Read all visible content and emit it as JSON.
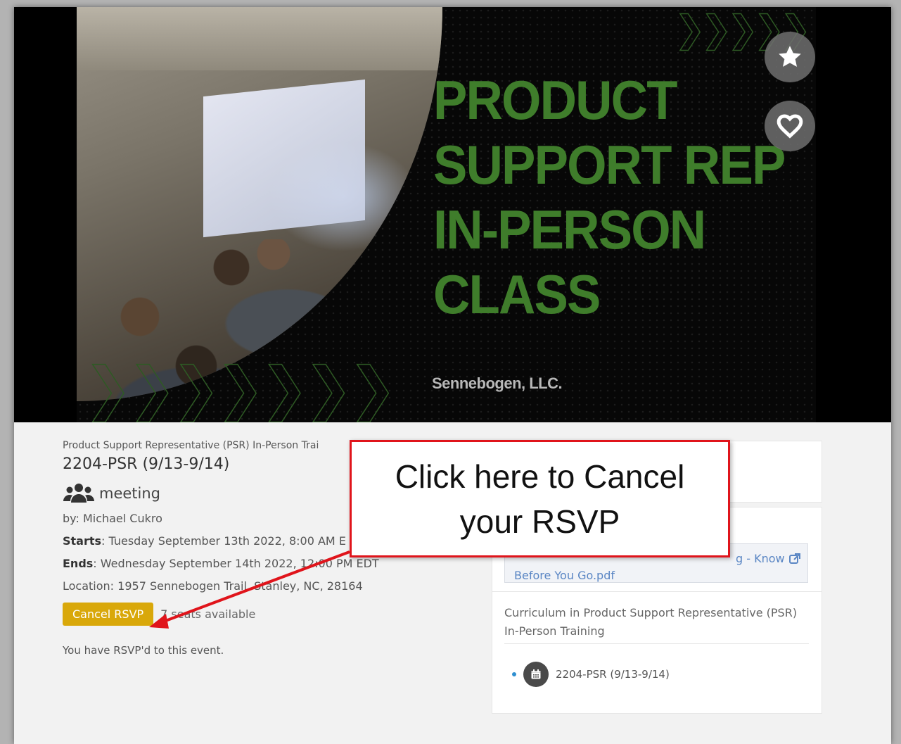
{
  "hero": {
    "title_lines": [
      "PRODUCT",
      "SUPPORT REP",
      "IN-PERSON",
      "CLASS"
    ],
    "company": "Sennebogen, LLC.",
    "favorite_icon": "star-icon",
    "like_icon": "heart-icon"
  },
  "event": {
    "breadcrumb": "Product Support Representative (PSR) In-Person Trai",
    "title": "2204-PSR (9/13-9/14)",
    "type_icon": "users-icon",
    "type_label": "meeting",
    "by": "by: Michael Cukro",
    "starts_label": "Starts",
    "starts_value": ": Tuesday September 13th 2022, 8:00 AM E",
    "ends_label": "Ends",
    "ends_value": ": Wednesday September 14th 2022, 12:00 PM EDT",
    "location": "Location: 1957 Sennebogen Trail, Stanley, NC, 28164",
    "cancel_label": "Cancel RSVP",
    "seats": "7 seats available",
    "rsvp_note": "You have RSVP'd to this event."
  },
  "sidebar": {
    "attachment_tail": "g - Know",
    "attachment_line2": "Before You Go.pdf",
    "curriculum_title": "Curriculum in Product Support Representative (PSR) In-Person Training",
    "curriculum_item": "2204-PSR (9/13-9/14)"
  },
  "callout": {
    "text": "Click here to Cancel your RSVP"
  },
  "colors": {
    "accent_gold": "#d9a80a",
    "title_green": "#3f7d2b",
    "callout_red": "#e0141b",
    "link_blue": "#5a86c4"
  }
}
